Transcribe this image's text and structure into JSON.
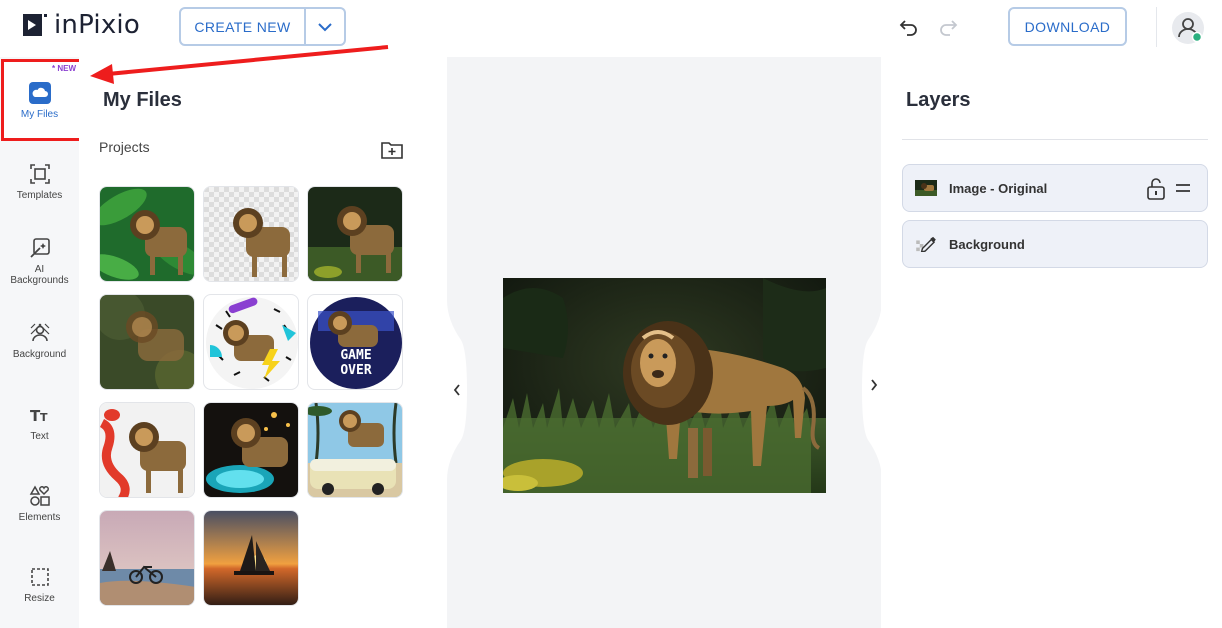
{
  "app": {
    "logo_text": "inPixio"
  },
  "toolbar": {
    "create_new_label": "CREATE NEW",
    "download_label": "DOWNLOAD"
  },
  "leftnav": {
    "new_badge": "* NEW",
    "items": [
      {
        "label": "My Files",
        "icon": "cloud-icon"
      },
      {
        "label": "Templates",
        "icon": "templates-icon"
      },
      {
        "label": "AI Backgrounds",
        "icon": "ai-backgrounds-icon"
      },
      {
        "label": "Background",
        "icon": "background-icon"
      },
      {
        "label": "Text",
        "icon": "text-icon"
      },
      {
        "label": "Elements",
        "icon": "elements-icon"
      },
      {
        "label": "Resize",
        "icon": "resize-icon"
      }
    ]
  },
  "files": {
    "title": "My Files",
    "projects_label": "Projects",
    "thumbnails": [
      {
        "name": "lion-green-leaves"
      },
      {
        "name": "lion-transparent"
      },
      {
        "name": "lion-dark-grass"
      },
      {
        "name": "lion-blurred"
      },
      {
        "name": "lion-memphis-circle"
      },
      {
        "name": "lion-game-over-circle"
      },
      {
        "name": "lion-balloons"
      },
      {
        "name": "lion-neon-portal"
      },
      {
        "name": "lion-van-beach"
      },
      {
        "name": "beach-bicycle"
      },
      {
        "name": "sailboat-sunset"
      }
    ],
    "overlay_text": [
      "GAME",
      "OVER"
    ]
  },
  "layers": {
    "title": "Layers",
    "items": [
      {
        "label": "Image - Original"
      },
      {
        "label": "Background"
      }
    ]
  },
  "colors": {
    "accent": "#2a6cc9",
    "annotation": "#ee1d1d",
    "badge": "#8a3fd1"
  }
}
